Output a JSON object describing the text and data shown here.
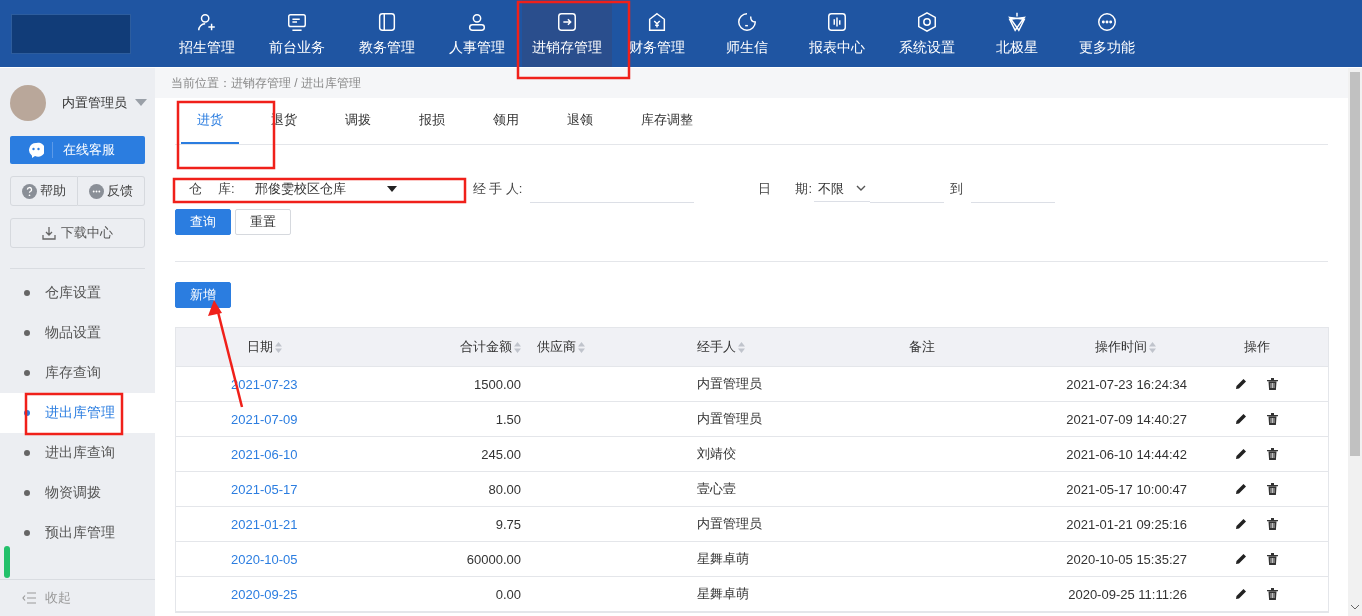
{
  "nav": {
    "items": [
      {
        "label": "招生管理",
        "selected": false
      },
      {
        "label": "前台业务",
        "selected": false
      },
      {
        "label": "教务管理",
        "selected": false
      },
      {
        "label": "人事管理",
        "selected": false
      },
      {
        "label": "进销存管理",
        "selected": true
      },
      {
        "label": "财务管理",
        "selected": false
      },
      {
        "label": "师生信",
        "selected": false
      },
      {
        "label": "报表中心",
        "selected": false
      },
      {
        "label": "系统设置",
        "selected": false
      },
      {
        "label": "北极星",
        "selected": false
      },
      {
        "label": "更多功能",
        "selected": false
      }
    ]
  },
  "user": {
    "name": "内置管理员"
  },
  "sidebar": {
    "service_button": "在线客服",
    "help": "帮助",
    "feedback": "反馈",
    "download": "下载中心",
    "items": [
      {
        "label": "仓库设置",
        "selected": false
      },
      {
        "label": "物品设置",
        "selected": false
      },
      {
        "label": "库存查询",
        "selected": false
      },
      {
        "label": "进出库管理",
        "selected": true
      },
      {
        "label": "进出库查询",
        "selected": false
      },
      {
        "label": "物资调拨",
        "selected": false
      },
      {
        "label": "预出库管理",
        "selected": false
      }
    ],
    "collapse": "收起"
  },
  "breadcrumb": {
    "label": "当前位置：",
    "path": "进销存管理 / 进出库管理"
  },
  "tabs": [
    {
      "label": "进货",
      "selected": true
    },
    {
      "label": "退货",
      "selected": false
    },
    {
      "label": "调拨",
      "selected": false
    },
    {
      "label": "报损",
      "selected": false
    },
    {
      "label": "领用",
      "selected": false
    },
    {
      "label": "退领",
      "selected": false
    },
    {
      "label": "库存调整",
      "selected": false
    }
  ],
  "filters": {
    "warehouse_label_1": "仓",
    "warehouse_label_2": "库:",
    "warehouse_value": "邢俊雯校区仓库",
    "handler_label": "经 手 人:",
    "date_label_1": "日",
    "date_label_2": "期:",
    "date_range": "不限",
    "date_to": "到"
  },
  "buttons": {
    "query": "查询",
    "reset": "重置",
    "add": "新增"
  },
  "table": {
    "columns": [
      {
        "label": "日期",
        "sortable": true
      },
      {
        "label": "合计金额",
        "sortable": true
      },
      {
        "label": "供应商",
        "sortable": true
      },
      {
        "label": "经手人",
        "sortable": true
      },
      {
        "label": "备注",
        "sortable": false
      },
      {
        "label": "操作时间",
        "sortable": true
      },
      {
        "label": "操作",
        "sortable": false
      }
    ],
    "rows": [
      [
        "2021-07-23",
        "1500.00",
        "",
        "内置管理员",
        "",
        "2021-07-23 16:24:34"
      ],
      [
        "2021-07-09",
        "1.50",
        "",
        "内置管理员",
        "",
        "2021-07-09 14:40:27"
      ],
      [
        "2021-06-10",
        "245.00",
        "",
        "刘靖佼",
        "",
        "2021-06-10 14:44:42"
      ],
      [
        "2021-05-17",
        "80.00",
        "",
        "壹心壹",
        "",
        "2021-05-17 10:00:47"
      ],
      [
        "2021-01-21",
        "9.75",
        "",
        "内置管理员",
        "",
        "2021-01-21 09:25:16"
      ],
      [
        "2020-10-05",
        "60000.00",
        "",
        "星舞卓萌",
        "",
        "2020-10-05 15:35:27"
      ],
      [
        "2020-09-25",
        "0.00",
        "",
        "星舞卓萌",
        "",
        "2020-09-25 11:11:26"
      ]
    ]
  }
}
